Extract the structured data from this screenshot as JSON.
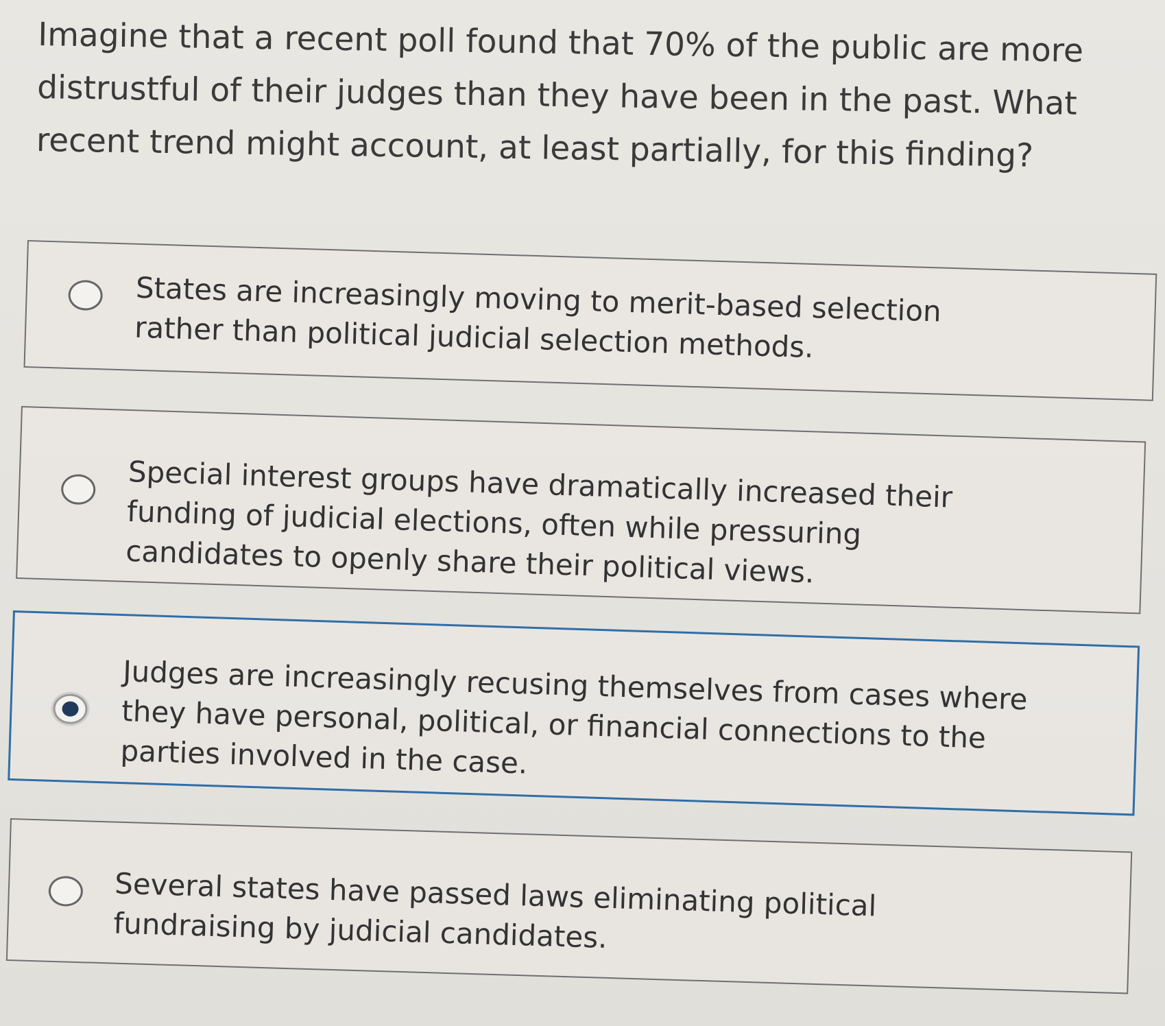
{
  "question": {
    "text": "Imagine that a recent poll found that 70% of the public are more distrustful of their judges than they have been in the past. What recent trend might account, at least partially, for this finding?"
  },
  "options": [
    {
      "label": "States are increasingly moving to merit-based selection rather than political judicial selection methods.",
      "selected": false
    },
    {
      "label": "Special interest groups have dramatically increased their funding of judicial elections, often while pressuring candidates to openly share their political views.",
      "selected": false
    },
    {
      "label": "Judges are increasingly recusing themselves from cases where they have personal, political, or financial connections to the parties involved in the case.",
      "selected": true
    },
    {
      "label": "Several states have passed laws eliminating political fundraising by judicial candidates.",
      "selected": false
    }
  ],
  "colors": {
    "selected_border": "#2f6ea8",
    "radio_dot": "#1f3b5c"
  }
}
